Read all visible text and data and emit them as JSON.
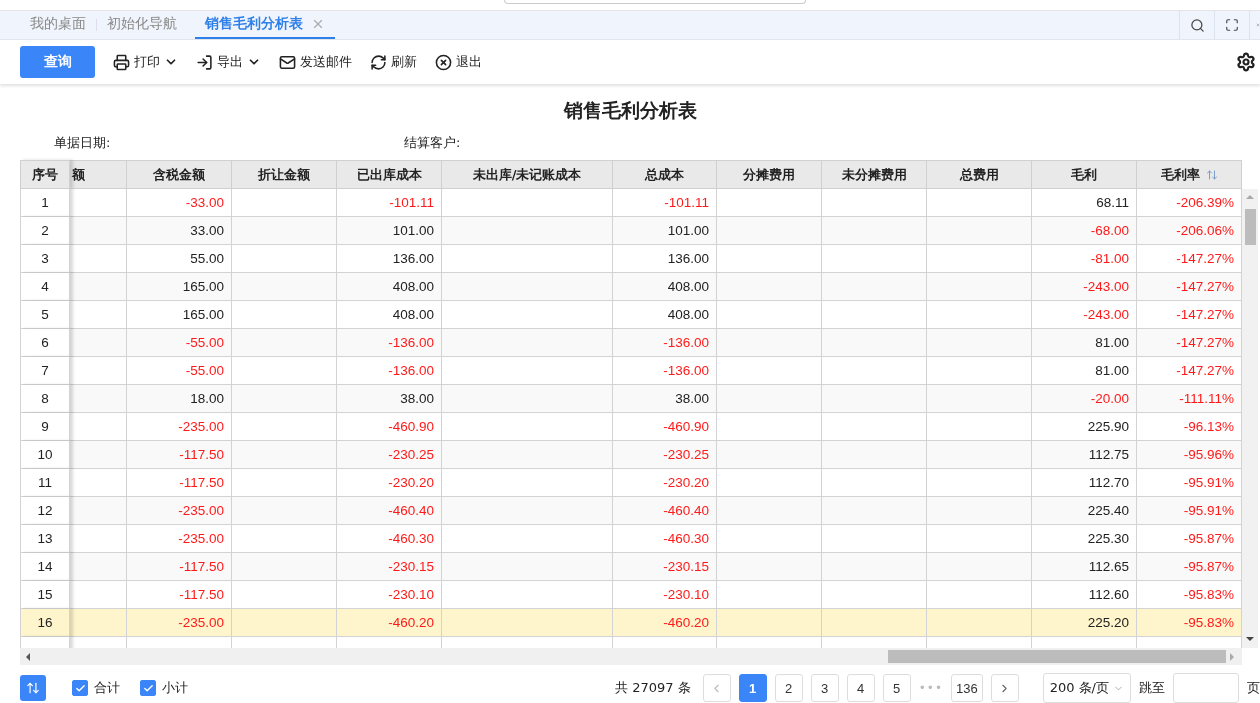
{
  "tabs": [
    {
      "label": "我的桌面",
      "selected": false,
      "closable": false
    },
    {
      "label": "初始化导航",
      "selected": false,
      "closable": false
    },
    {
      "label": "销售毛利分析表",
      "selected": true,
      "closable": true
    }
  ],
  "toolbar": {
    "query_button": "查询",
    "actions": [
      {
        "kind": "print",
        "label": "打印",
        "dropdown": true
      },
      {
        "kind": "export",
        "label": "导出",
        "dropdown": true
      },
      {
        "kind": "mail",
        "label": "发送邮件",
        "dropdown": false
      },
      {
        "kind": "refresh",
        "label": "刷新",
        "dropdown": false
      },
      {
        "kind": "exit",
        "label": "退出",
        "dropdown": false
      }
    ]
  },
  "report": {
    "title": "销售毛利分析表",
    "filters": [
      {
        "label": "单据日期:"
      },
      {
        "label": "结算客户:"
      }
    ]
  },
  "table": {
    "columns": [
      {
        "label": "序号"
      },
      {
        "label": "额"
      },
      {
        "label": "含税金额"
      },
      {
        "label": "折让金额"
      },
      {
        "label": "已出库成本"
      },
      {
        "label": "未出库/未记账成本"
      },
      {
        "label": "总成本"
      },
      {
        "label": "分摊费用"
      },
      {
        "label": "未分摊费用"
      },
      {
        "label": "总费用"
      },
      {
        "label": "毛利"
      },
      {
        "label": "毛利率",
        "sorted": true
      }
    ],
    "rows": [
      {
        "selected": false,
        "cells": [
          "1",
          "",
          "-33.00",
          "",
          "-101.11",
          "",
          "-101.11",
          "",
          "",
          "",
          "68.11",
          "-206.39%"
        ]
      },
      {
        "selected": false,
        "cells": [
          "2",
          "",
          "33.00",
          "",
          "101.00",
          "",
          "101.00",
          "",
          "",
          "",
          "-68.00",
          "-206.06%"
        ]
      },
      {
        "selected": false,
        "cells": [
          "3",
          "",
          "55.00",
          "",
          "136.00",
          "",
          "136.00",
          "",
          "",
          "",
          "-81.00",
          "-147.27%"
        ]
      },
      {
        "selected": false,
        "cells": [
          "4",
          "",
          "165.00",
          "",
          "408.00",
          "",
          "408.00",
          "",
          "",
          "",
          "-243.00",
          "-147.27%"
        ]
      },
      {
        "selected": false,
        "cells": [
          "5",
          "",
          "165.00",
          "",
          "408.00",
          "",
          "408.00",
          "",
          "",
          "",
          "-243.00",
          "-147.27%"
        ]
      },
      {
        "selected": false,
        "cells": [
          "6",
          "",
          "-55.00",
          "",
          "-136.00",
          "",
          "-136.00",
          "",
          "",
          "",
          "81.00",
          "-147.27%"
        ]
      },
      {
        "selected": false,
        "cells": [
          "7",
          "",
          "-55.00",
          "",
          "-136.00",
          "",
          "-136.00",
          "",
          "",
          "",
          "81.00",
          "-147.27%"
        ]
      },
      {
        "selected": false,
        "cells": [
          "8",
          "",
          "18.00",
          "",
          "38.00",
          "",
          "38.00",
          "",
          "",
          "",
          "-20.00",
          "-111.11%"
        ]
      },
      {
        "selected": false,
        "cells": [
          "9",
          "",
          "-235.00",
          "",
          "-460.90",
          "",
          "-460.90",
          "",
          "",
          "",
          "225.90",
          "-96.13%"
        ]
      },
      {
        "selected": false,
        "cells": [
          "10",
          "",
          "-117.50",
          "",
          "-230.25",
          "",
          "-230.25",
          "",
          "",
          "",
          "112.75",
          "-95.96%"
        ]
      },
      {
        "selected": false,
        "cells": [
          "11",
          "",
          "-117.50",
          "",
          "-230.20",
          "",
          "-230.20",
          "",
          "",
          "",
          "112.70",
          "-95.91%"
        ]
      },
      {
        "selected": false,
        "cells": [
          "12",
          "",
          "-235.00",
          "",
          "-460.40",
          "",
          "-460.40",
          "",
          "",
          "",
          "225.40",
          "-95.91%"
        ]
      },
      {
        "selected": false,
        "cells": [
          "13",
          "",
          "-235.00",
          "",
          "-460.30",
          "",
          "-460.30",
          "",
          "",
          "",
          "225.30",
          "-95.87%"
        ]
      },
      {
        "selected": false,
        "cells": [
          "14",
          "",
          "-117.50",
          "",
          "-230.15",
          "",
          "-230.15",
          "",
          "",
          "",
          "112.65",
          "-95.87%"
        ]
      },
      {
        "selected": false,
        "cells": [
          "15",
          "",
          "-117.50",
          "",
          "-230.10",
          "",
          "-230.10",
          "",
          "",
          "",
          "112.60",
          "-95.83%"
        ]
      },
      {
        "selected": true,
        "cells": [
          "16",
          "",
          "-235.00",
          "",
          "-460.20",
          "",
          "-460.20",
          "",
          "",
          "",
          "225.20",
          "-95.83%"
        ]
      }
    ]
  },
  "footer": {
    "totals": [
      {
        "label": "合计",
        "checked": true
      },
      {
        "label": "小计",
        "checked": true
      }
    ],
    "total_count": "共 27097 条",
    "pages": [
      {
        "label": "1",
        "selected": true
      },
      {
        "label": "2",
        "selected": false
      },
      {
        "label": "3",
        "selected": false
      },
      {
        "label": "4",
        "selected": false
      },
      {
        "label": "5",
        "selected": false
      },
      {
        "label": "•••",
        "kind": "ellipsis"
      },
      {
        "label": "136",
        "selected": false
      }
    ],
    "page_size": "200 条/页",
    "jump_label": "跳至",
    "page_suffix": "页"
  }
}
